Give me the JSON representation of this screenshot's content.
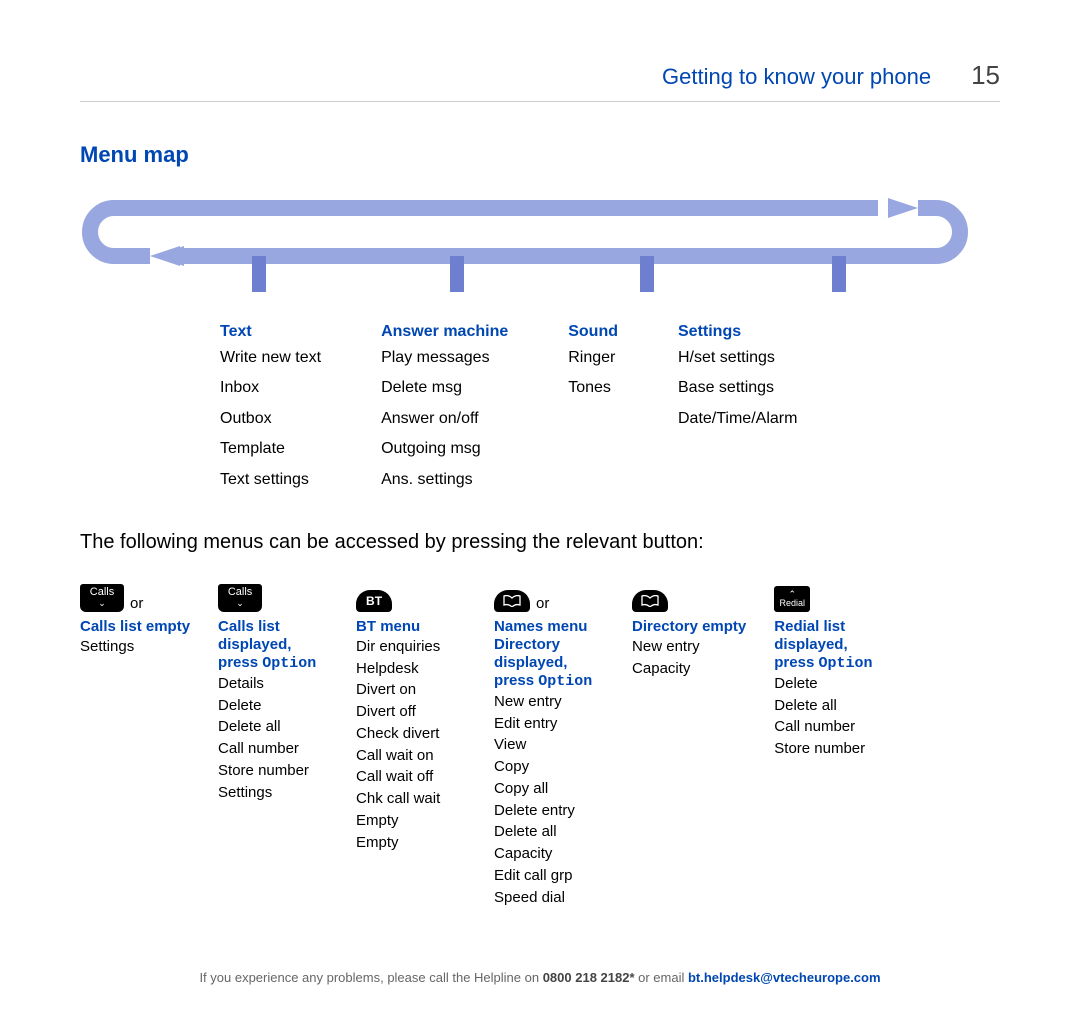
{
  "header": {
    "chapter": "Getting to know your phone",
    "page": "15"
  },
  "section_title": "Menu map",
  "menu": {
    "cols": [
      {
        "head": "Text",
        "items": [
          "Write new text",
          "Inbox",
          "Outbox",
          "Template",
          "Text settings"
        ]
      },
      {
        "head": "Answer machine",
        "items": [
          "Play messages",
          "Delete msg",
          "Answer on/off",
          "Outgoing msg",
          "Ans. settings"
        ]
      },
      {
        "head": "Sound",
        "items": [
          "Ringer",
          "Tones"
        ]
      },
      {
        "head": "Settings",
        "items": [
          "H/set settings",
          "Base settings",
          "Date/Time/Alarm"
        ]
      }
    ]
  },
  "body_text": "The following menus can be accessed by pressing the relevant button:",
  "or": "or",
  "buttons": {
    "calls_label": "Calls",
    "bt_label": "BT",
    "redial_label": "Redial"
  },
  "btncols": {
    "calls_empty": {
      "head": "Calls list empty",
      "items": [
        "Settings"
      ]
    },
    "calls_list": {
      "head1": "Calls list",
      "head2": "displayed,",
      "head3a": "press ",
      "head3b": "Option",
      "items": [
        "Details",
        "Delete",
        "Delete all",
        "Call number",
        "Store number",
        "Settings"
      ]
    },
    "bt_menu": {
      "head": "BT menu",
      "items": [
        "Dir enquiries",
        "Helpdesk",
        "Divert on",
        "Divert off",
        "Check divert",
        "Call wait on",
        "Call wait off",
        "Chk call wait",
        "Empty",
        "Empty"
      ]
    },
    "names": {
      "head1": "Names menu",
      "head2": "Directory",
      "head3": "displayed,",
      "head4a": "press ",
      "head4b": "Option",
      "items": [
        "New entry",
        "Edit entry",
        "View",
        "Copy",
        "Copy all",
        "Delete entry",
        "Delete all",
        "Capacity",
        "Edit call grp",
        "Speed dial"
      ]
    },
    "dir_empty": {
      "head": "Directory empty",
      "items": [
        "New entry",
        "Capacity"
      ]
    },
    "redial": {
      "head1": "Redial list",
      "head2": "displayed,",
      "head3a": "press ",
      "head3b": "Option",
      "items": [
        "Delete",
        "Delete all",
        "Call number",
        "Store number"
      ]
    }
  },
  "footer": {
    "t1": "If you experience any problems, please call the Helpline on ",
    "phone": "0800 218 2182*",
    "t2": " or email ",
    "email": "bt.helpdesk@vtecheurope.com"
  }
}
